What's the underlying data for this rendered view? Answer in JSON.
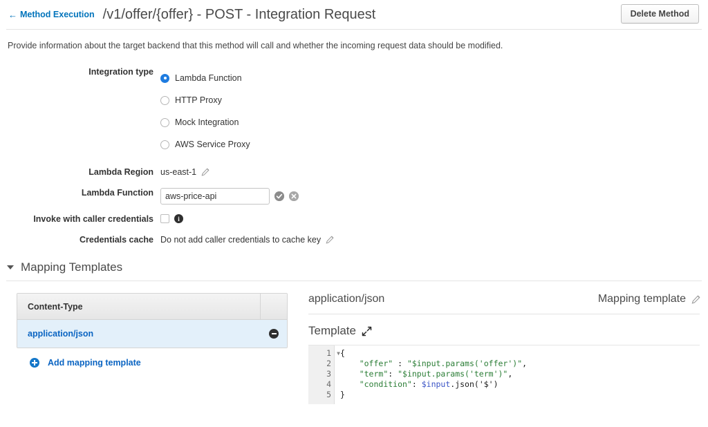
{
  "header": {
    "back_link": "Method Execution",
    "back_arrow_icon": "arrow-left-icon",
    "title": "/v1/offer/{offer} - POST - Integration Request",
    "delete_button": "Delete Method"
  },
  "description": "Provide information about the target backend that this method will call and whether the incoming request data should be modified.",
  "form": {
    "integration_type": {
      "label": "Integration type",
      "options": [
        {
          "label": "Lambda Function",
          "selected": true
        },
        {
          "label": "HTTP Proxy",
          "selected": false
        },
        {
          "label": "Mock Integration",
          "selected": false
        },
        {
          "label": "AWS Service Proxy",
          "selected": false
        }
      ]
    },
    "lambda_region": {
      "label": "Lambda Region",
      "value": "us-east-1",
      "edit_icon": "pencil-icon"
    },
    "lambda_function": {
      "label": "Lambda Function",
      "value": "aws-price-api",
      "placeholder": "",
      "confirm_icon": "check-circle-icon",
      "cancel_icon": "x-circle-icon"
    },
    "invoke_with_caller_credentials": {
      "label": "Invoke with caller credentials",
      "checked": false,
      "info_icon": "info-icon"
    },
    "credentials_cache": {
      "label": "Credentials cache",
      "value": "Do not add caller credentials to cache key",
      "edit_icon": "pencil-icon"
    }
  },
  "mapping_templates": {
    "section_title": "Mapping Templates",
    "collapse_icon": "caret-down-icon",
    "table": {
      "column_header": "Content-Type",
      "rows": [
        {
          "content_type": "application/json",
          "remove_icon": "minus-circle-icon"
        }
      ],
      "add_label": "Add mapping template",
      "add_icon": "plus-circle-icon"
    },
    "detail": {
      "content_type": "application/json",
      "mapping_template_label": "Mapping template",
      "edit_icon": "pencil-icon",
      "template_label": "Template",
      "expand_icon": "expand-arrows-icon",
      "code_lines": [
        {
          "number": "1",
          "foldable": true,
          "tokens": [
            {
              "t": "plain",
              "v": "{"
            }
          ]
        },
        {
          "number": "2",
          "foldable": false,
          "tokens": [
            {
              "t": "plain",
              "v": "    "
            },
            {
              "t": "str",
              "v": "\"offer\""
            },
            {
              "t": "plain",
              "v": " : "
            },
            {
              "t": "str",
              "v": "\"$input.params('offer')\""
            },
            {
              "t": "plain",
              "v": ","
            }
          ]
        },
        {
          "number": "3",
          "foldable": false,
          "tokens": [
            {
              "t": "plain",
              "v": "    "
            },
            {
              "t": "str",
              "v": "\"term\""
            },
            {
              "t": "plain",
              "v": ": "
            },
            {
              "t": "str",
              "v": "\"$input.params('term')\""
            },
            {
              "t": "plain",
              "v": ","
            }
          ]
        },
        {
          "number": "4",
          "foldable": false,
          "tokens": [
            {
              "t": "plain",
              "v": "    "
            },
            {
              "t": "str",
              "v": "\"condition\""
            },
            {
              "t": "plain",
              "v": ": "
            },
            {
              "t": "var",
              "v": "$input"
            },
            {
              "t": "plain",
              "v": ".json('$')"
            }
          ]
        },
        {
          "number": "5",
          "foldable": false,
          "tokens": [
            {
              "t": "plain",
              "v": "}"
            }
          ]
        }
      ]
    }
  },
  "colors": {
    "link_blue": "#0073bb",
    "accent_blue": "#1f7ce0",
    "row_highlight": "#e3f0fa",
    "code_string_green": "#2a7d35",
    "code_var_blue": "#3b54c6"
  }
}
